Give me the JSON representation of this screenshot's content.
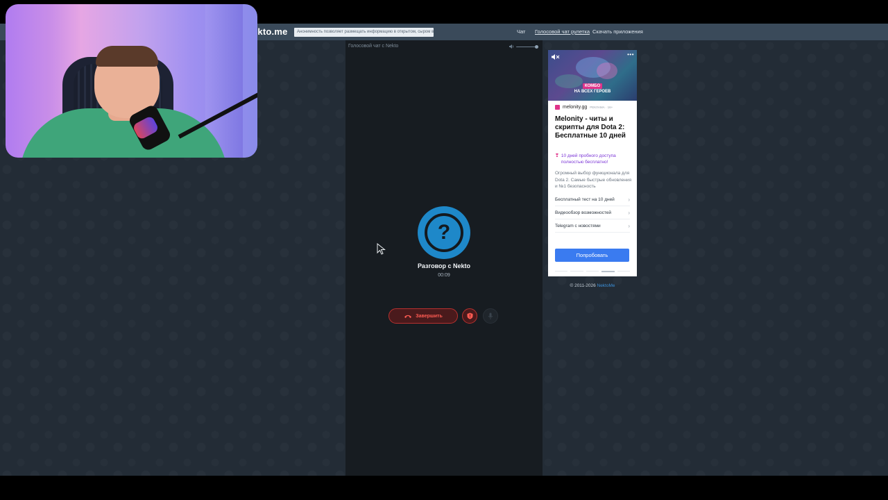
{
  "topbar": {
    "logo": "ekto.me",
    "tooltip": "Анонимность позволяет размещать информацию в открытом, сыром виде!",
    "nav": [
      {
        "label": "Чат"
      },
      {
        "label": "Голосовой чат рулетка"
      },
      {
        "label": "Скачать приложения"
      }
    ]
  },
  "chat": {
    "header_title": "Голосовой чат с Nekto",
    "caller_name": "Разговор с Nekto",
    "timer": "00:09",
    "end_label": "Завершить",
    "avatar_symbol": "?"
  },
  "ad": {
    "caption_line1": "КОМБО",
    "caption_line2": "НА ВСЕХ ГЕРОЕВ",
    "source": "melonity.gg",
    "tag": "РЕКЛАМА · 16+",
    "title": "Melonity - читы и скрипты для Dota 2: Бесплатные 10 дней",
    "promo": "10 дней пробного доступа полностью бесплатно!",
    "description": "Огромный выбор функционала для Dota 2. Самые быстрые обновления и №1 безопасность",
    "links": [
      {
        "label": "Бесплатный тест на 10 дней"
      },
      {
        "label": "Видеообзор возможностей"
      },
      {
        "label": "Telegram с новостями"
      }
    ],
    "cta": "Попробовать"
  },
  "footer": {
    "copyright": "© 2011-2026 ",
    "link": "NektoMe"
  },
  "colors": {
    "page_bg": "#232c36",
    "chat_bg": "#171c21",
    "accent_blue": "#1e88c9",
    "end_red": "#b8312f",
    "cta_blue": "#3a7bf0"
  }
}
